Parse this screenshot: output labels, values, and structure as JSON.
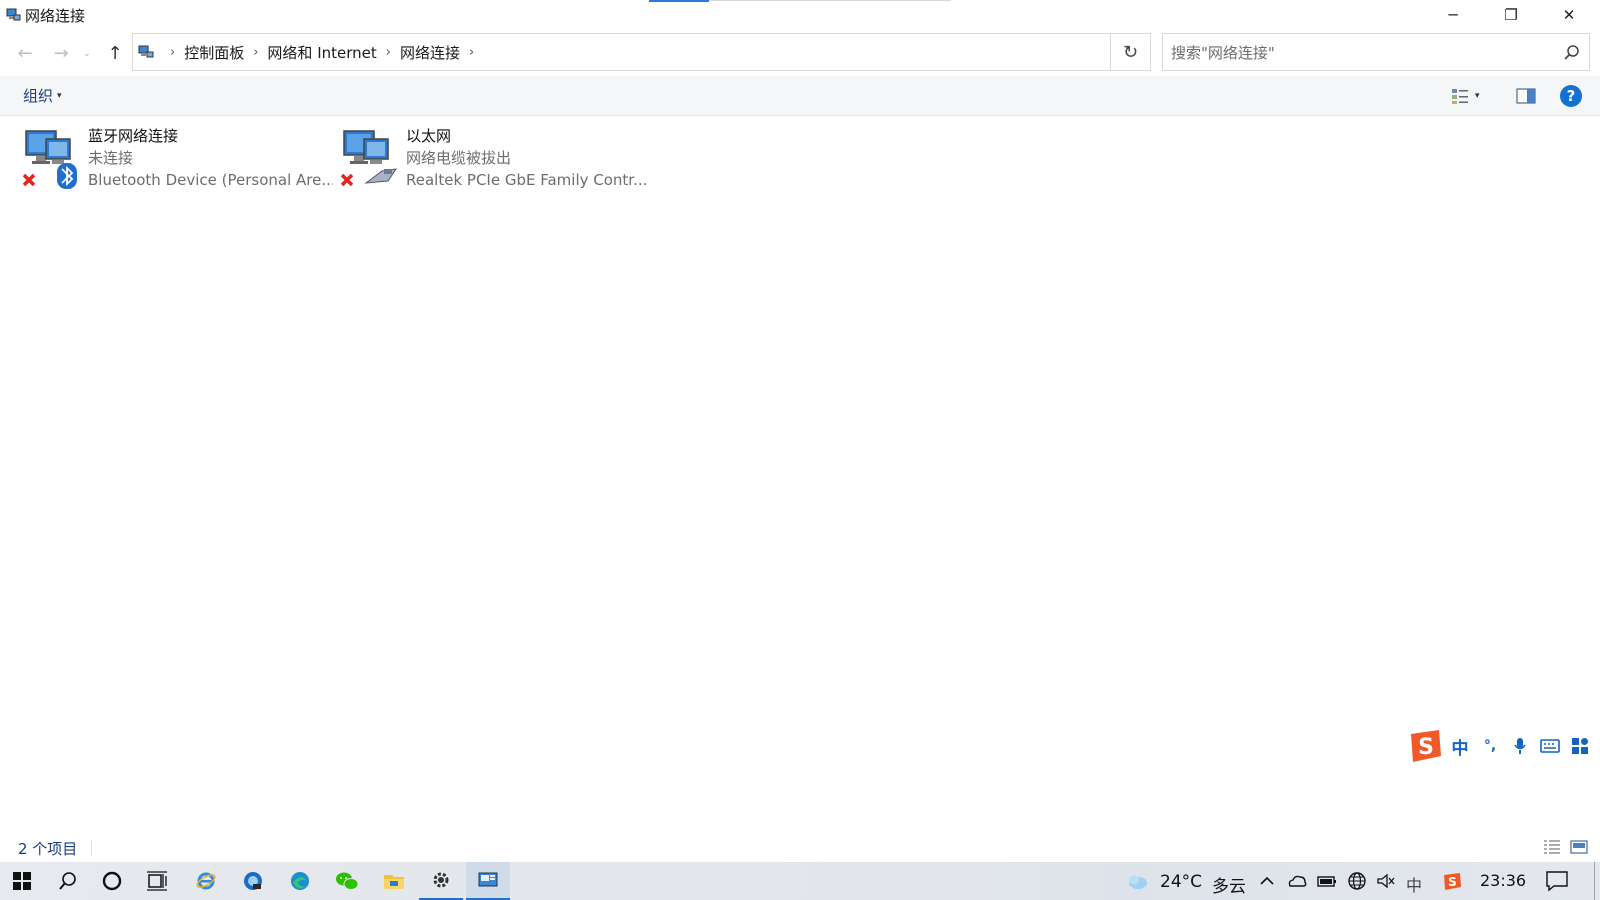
{
  "window": {
    "title": "网络连接",
    "minimize_glyph": "─",
    "maximize_glyph": "❐",
    "close_glyph": "✕"
  },
  "nav": {
    "back_glyph": "←",
    "forward_glyph": "→",
    "recent_glyph": "⌄",
    "up_glyph": "↑",
    "breadcrumb": [
      "控制面板",
      "网络和 Internet",
      "网络连接"
    ],
    "sep_glyph": "›",
    "refresh_glyph": "↻",
    "search_placeholder": "搜索\"网络连接\""
  },
  "toolbar": {
    "organize_label": "组织",
    "caret": "▾",
    "help_label": "?"
  },
  "connections": [
    {
      "name": "蓝牙网络连接",
      "status": "未连接",
      "device": "Bluetooth Device (Personal Are...",
      "icon": "bluetooth-network-icon"
    },
    {
      "name": "以太网",
      "status": "网络电缆被拔出",
      "device": "Realtek PCIe GbE Family Contr...",
      "icon": "ethernet-network-icon"
    }
  ],
  "ime": {
    "mode": "中",
    "punct": "°,",
    "icons": [
      "sogou-icon",
      "microphone-icon",
      "keyboard-icon",
      "toolbox-icon"
    ]
  },
  "statusbar": {
    "item_count": "2 个项目"
  },
  "taskbar": {
    "weather_temp": "24°C",
    "weather_desc": "多云",
    "ime_indicator": "中",
    "clock": "23:36",
    "icons": [
      "windows-start-icon",
      "search-icon",
      "cortana-icon",
      "task-view-icon",
      "ie-icon",
      "edge-beta-icon",
      "edge-icon",
      "wechat-icon",
      "file-explorer-icon",
      "settings-icon",
      "network-connections-icon"
    ]
  },
  "colors": {
    "accent": "#1f6fd0",
    "link_text": "#1a3e7a",
    "error_x": "#e3261c",
    "bluetooth": "#1f6fd0"
  }
}
